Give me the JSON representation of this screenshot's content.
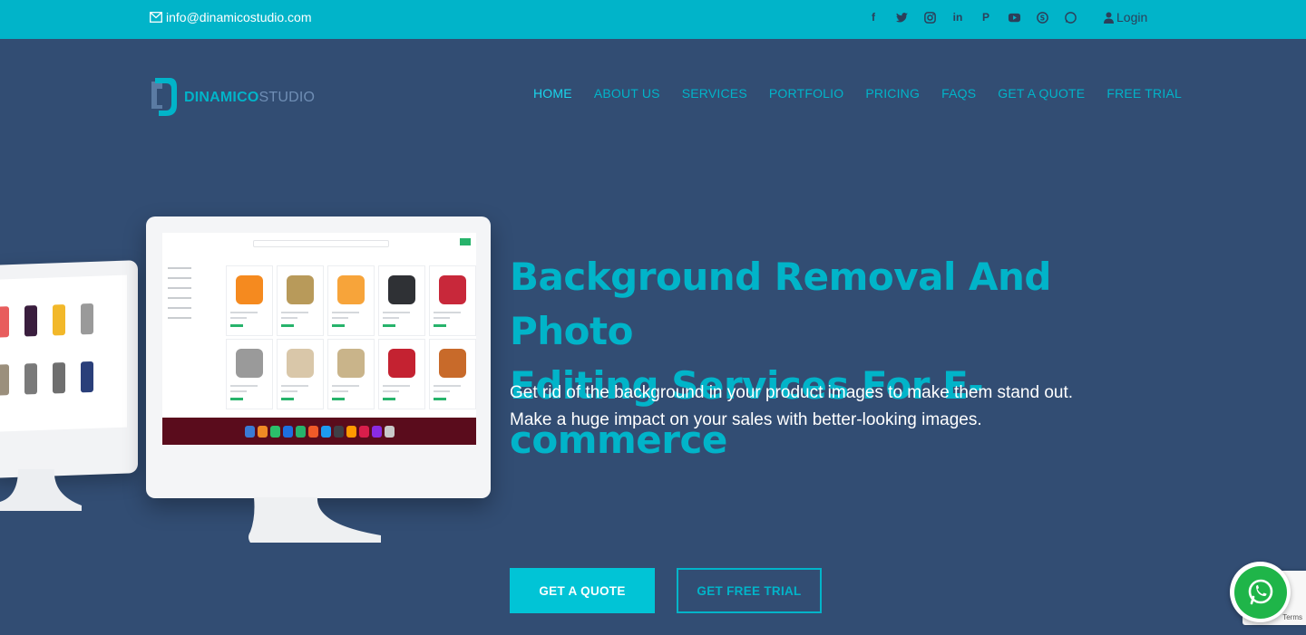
{
  "topbar": {
    "email": "info@dinamicostudio.com",
    "social_icons": [
      "facebook-icon",
      "twitter-icon",
      "instagram-icon",
      "linkedin-icon",
      "pinterest-icon",
      "youtube-icon",
      "skype-icon",
      "whatsapp-icon"
    ],
    "login_label": "Login"
  },
  "brand": {
    "name_bold": "DINAMICO",
    "name_light": "STUDIO"
  },
  "nav": {
    "items": [
      {
        "label": "HOME",
        "active": true
      },
      {
        "label": "ABOUT US"
      },
      {
        "label": "SERVICES"
      },
      {
        "label": "PORTFOLIO"
      },
      {
        "label": "PRICING"
      },
      {
        "label": "FAQS"
      },
      {
        "label": "GET A QUOTE"
      },
      {
        "label": "FREE TRIAL"
      }
    ]
  },
  "hero": {
    "headline_line1": "Background Removal And Photo",
    "headline_line2": "Editing Services For E-commerce",
    "subtext_line1": "Get rid of the background in your product images to make them stand out.",
    "subtext_line2": "Make a huge impact on your sales with better-looking images.",
    "primary_cta": "GET A QUOTE",
    "secondary_cta": "GET FREE TRIAL"
  },
  "recaptcha": {
    "terms": "Terms"
  },
  "colors": {
    "accent": "#01b4c9",
    "background": "#324d73",
    "whatsapp": "#1fb549"
  }
}
